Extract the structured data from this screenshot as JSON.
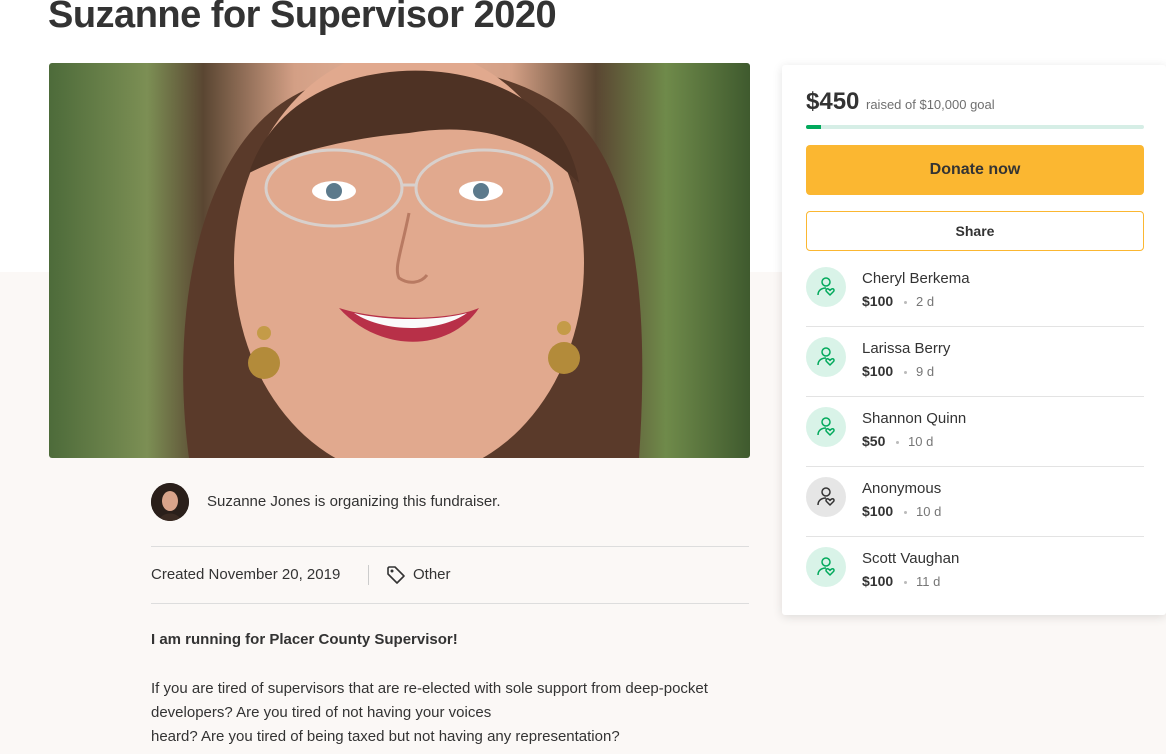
{
  "campaign": {
    "title": "Suzanne for Supervisor 2020",
    "organizer_text": "Suzanne Jones is organizing this fundraiser.",
    "created": "Created November 20, 2019",
    "category": "Other"
  },
  "story": {
    "lead": "I am running for Placer County Supervisor!",
    "lines": [
      "If you are tired of supervisors that are re-elected with sole support from deep-pocket",
      "developers? Are you tired of not having your voices",
      "heard?  Are you tired of being taxed but not having any representation?"
    ]
  },
  "funding": {
    "raised": "$450",
    "goal_text": "raised of $10,000 goal",
    "progress_fraction": 0.045,
    "donate_label": "Donate now",
    "share_label": "Share"
  },
  "donations": [
    {
      "name": "Cheryl Berkema",
      "amount": "$100",
      "time": "2 d",
      "icon": "donor-heart-icon",
      "color": "#02a95c"
    },
    {
      "name": "Larissa Berry",
      "amount": "$100",
      "time": "9 d",
      "icon": "donor-heart-icon",
      "color": "#02a95c"
    },
    {
      "name": "Shannon Quinn",
      "amount": "$50",
      "time": "10 d",
      "icon": "donor-heart-icon",
      "color": "#02a95c"
    },
    {
      "name": "Anonymous",
      "amount": "$100",
      "time": "10 d",
      "icon": "anonymous-donor-icon",
      "color": "#333333"
    },
    {
      "name": "Scott Vaughan",
      "amount": "$100",
      "time": "11 d",
      "icon": "donor-heart-icon",
      "color": "#02a95c"
    }
  ],
  "colors": {
    "accent_yellow": "#fbb731",
    "brand_green": "#02a95c",
    "progress_track": "#d6eee6"
  }
}
